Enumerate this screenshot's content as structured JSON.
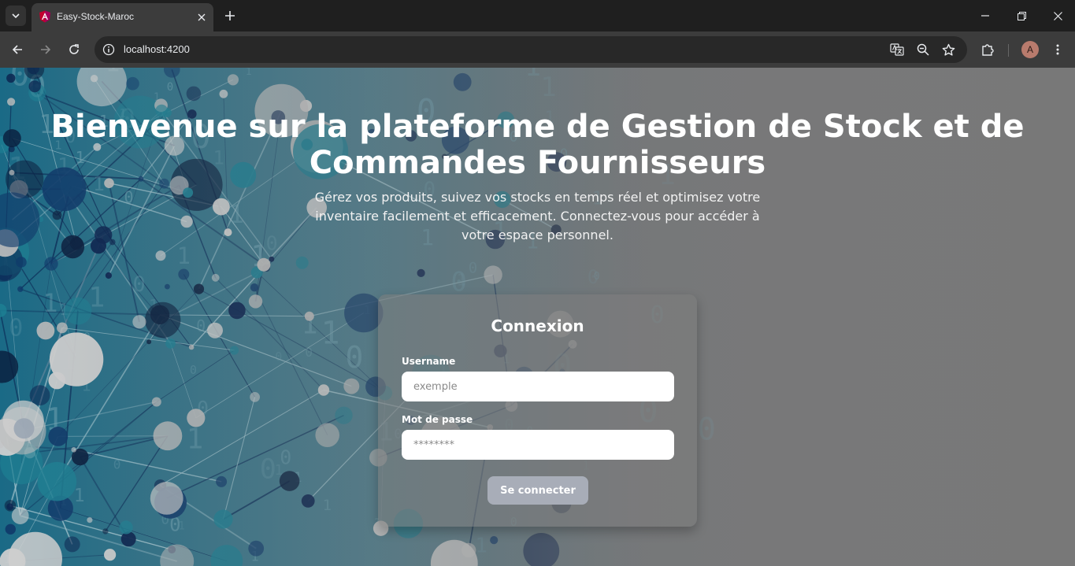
{
  "browser": {
    "tab_title": "Easy-Stock-Maroc",
    "url": "localhost:4200",
    "avatar_letter": "A",
    "theme_colors": {
      "frame": "#1f1f1f",
      "toolbar": "#3c3c3c",
      "omnibox": "#282828"
    }
  },
  "page": {
    "hero": {
      "title": "Bienvenue sur la plateforme de Gestion de Stock et de Commandes Fournisseurs",
      "subtitle": "Gérez vos produits, suivez vos stocks en temps réel et optimisez votre inventaire facilement et efficacement. Connectez-vous pour accéder à votre espace personnel."
    },
    "login": {
      "heading": "Connexion",
      "username_label": "Username",
      "username_placeholder": "exemple",
      "password_label": "Mot de passe",
      "password_placeholder": "********",
      "submit_label": "Se connecter"
    },
    "colors": {
      "button": "#a8adb8",
      "background_accent": "#1a5f80"
    }
  }
}
